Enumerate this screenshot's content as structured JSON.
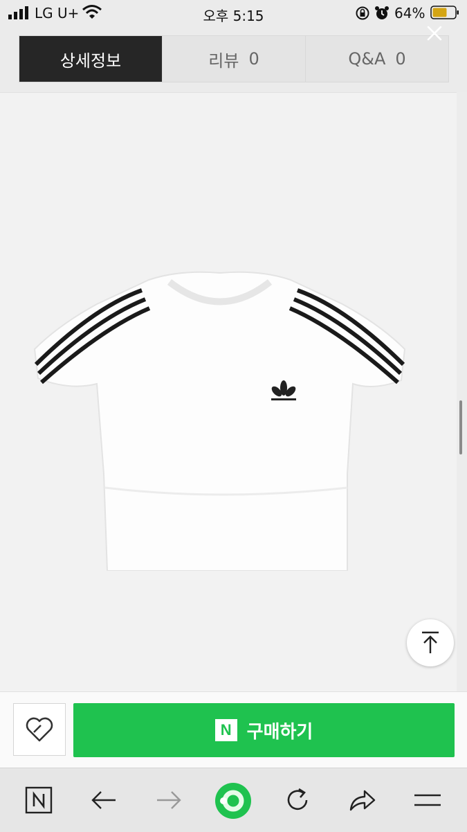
{
  "status_bar": {
    "carrier": "LG U+",
    "time": "오후 5:15",
    "battery": "64%",
    "icons": [
      "signal-icon",
      "wifi-icon",
      "rotation-lock-icon",
      "alarm-icon",
      "battery-icon"
    ]
  },
  "tabs": [
    {
      "label": "상세정보",
      "count": "",
      "active": true
    },
    {
      "label": "리뷰",
      "count": "0",
      "active": false
    },
    {
      "label": "Q&A",
      "count": "0",
      "active": false
    }
  ],
  "product_image": {
    "description_icon": "white-cropped-tshirt-with-three-black-shoulder-stripes"
  },
  "purchase": {
    "buy_label": "구매하기",
    "n_logo": "N"
  },
  "colors": {
    "buy_green": "#1fc24f",
    "active_tab": "#262626"
  }
}
